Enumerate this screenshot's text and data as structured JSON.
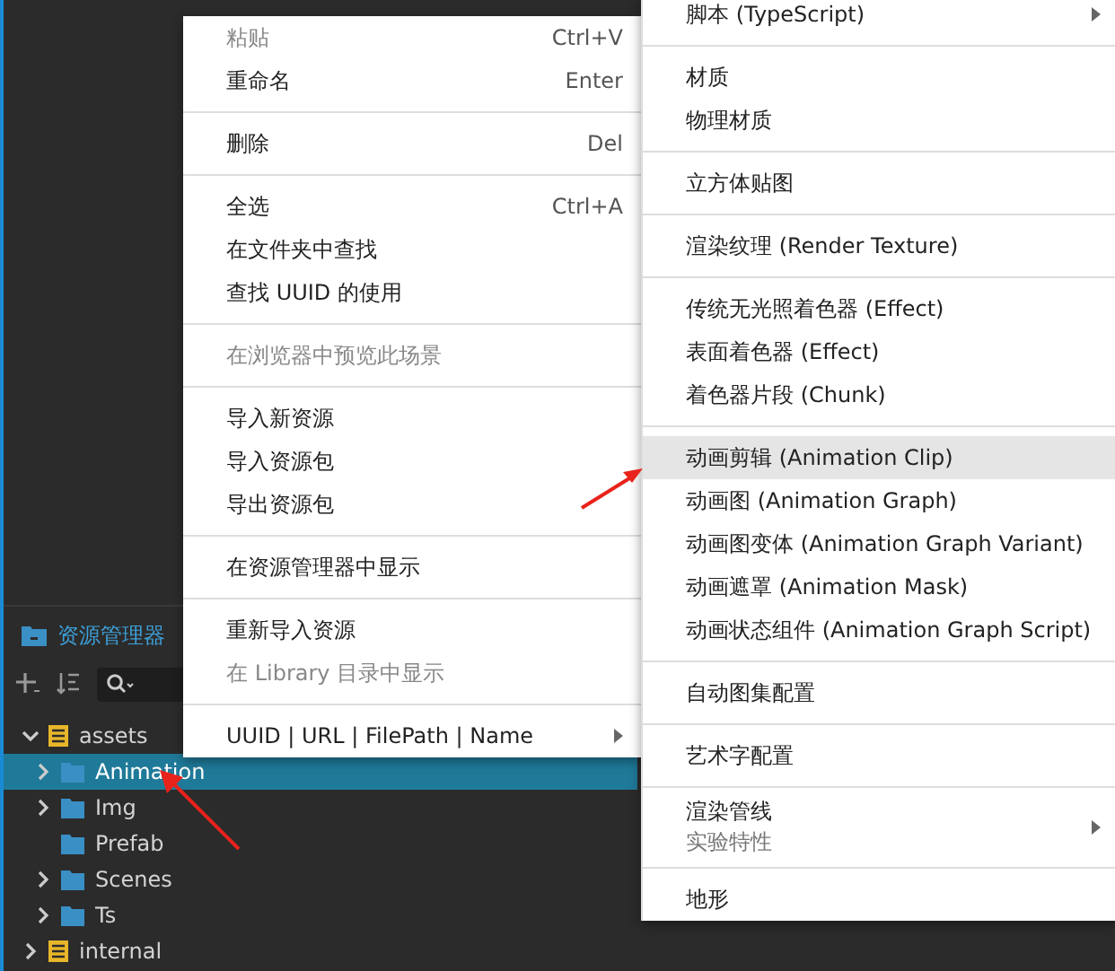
{
  "asset_panel": {
    "title": "资源管理器",
    "tree": [
      {
        "label": "assets",
        "kind": "database",
        "expandable": true,
        "expanded": true,
        "selected": false,
        "children": [
          {
            "label": "Animation",
            "kind": "folder",
            "expandable": true,
            "expanded": false,
            "selected": true
          },
          {
            "label": "Img",
            "kind": "folder",
            "expandable": true,
            "expanded": false,
            "selected": false
          },
          {
            "label": "Prefab",
            "kind": "folder",
            "selected": false
          },
          {
            "label": "Scenes",
            "kind": "folder",
            "expandable": true,
            "expanded": false,
            "selected": false
          },
          {
            "label": "Ts",
            "kind": "folder",
            "expandable": true,
            "expanded": false,
            "selected": false
          }
        ]
      },
      {
        "label": "internal",
        "kind": "database",
        "expandable": true,
        "expanded": false,
        "selected": false
      }
    ]
  },
  "context_menu": {
    "items": [
      {
        "kind": "item",
        "label": "粘贴",
        "shortcut": "Ctrl+V",
        "disabled": true
      },
      {
        "kind": "item",
        "label": "重命名",
        "shortcut": "Enter",
        "disabled": false
      },
      {
        "kind": "separator"
      },
      {
        "kind": "item",
        "label": "删除",
        "shortcut": "Del",
        "disabled": false
      },
      {
        "kind": "separator"
      },
      {
        "kind": "item",
        "label": "全选",
        "shortcut": "Ctrl+A",
        "disabled": false
      },
      {
        "kind": "item",
        "label": "在文件夹中查找",
        "disabled": false
      },
      {
        "kind": "item",
        "label": "查找 UUID 的使用",
        "disabled": false
      },
      {
        "kind": "separator"
      },
      {
        "kind": "item",
        "label": "在浏览器中预览此场景",
        "disabled": true
      },
      {
        "kind": "separator"
      },
      {
        "kind": "item",
        "label": "导入新资源",
        "disabled": false
      },
      {
        "kind": "item",
        "label": "导入资源包",
        "disabled": false
      },
      {
        "kind": "item",
        "label": "导出资源包",
        "disabled": false
      },
      {
        "kind": "separator"
      },
      {
        "kind": "item",
        "label": "在资源管理器中显示",
        "disabled": false
      },
      {
        "kind": "separator"
      },
      {
        "kind": "item",
        "label": "重新导入资源",
        "disabled": false
      },
      {
        "kind": "item",
        "label": "在 Library 目录中显示",
        "disabled": true
      },
      {
        "kind": "separator"
      },
      {
        "kind": "item",
        "label": "UUID | URL | FilePath | Name",
        "disabled": false,
        "submenu": true
      }
    ]
  },
  "create_submenu": {
    "items": [
      {
        "kind": "item",
        "label": "脚本 (TypeScript)",
        "submenu": true,
        "selected": false
      },
      {
        "kind": "separator"
      },
      {
        "kind": "item",
        "label": "材质",
        "selected": false
      },
      {
        "kind": "item",
        "label": "物理材质",
        "selected": false
      },
      {
        "kind": "separator"
      },
      {
        "kind": "item",
        "label": "立方体贴图",
        "selected": false
      },
      {
        "kind": "separator"
      },
      {
        "kind": "item",
        "label": "渲染纹理 (Render Texture)",
        "selected": false
      },
      {
        "kind": "separator"
      },
      {
        "kind": "item",
        "label": "传统无光照着色器 (Effect)",
        "selected": false
      },
      {
        "kind": "item",
        "label": "表面着色器 (Effect)",
        "selected": false
      },
      {
        "kind": "item",
        "label": "着色器片段 (Chunk)",
        "selected": false
      },
      {
        "kind": "separator"
      },
      {
        "kind": "item",
        "label": "动画剪辑 (Animation Clip)",
        "selected": true
      },
      {
        "kind": "item",
        "label": "动画图 (Animation Graph)",
        "selected": false
      },
      {
        "kind": "item",
        "label": "动画图变体 (Animation Graph Variant)",
        "selected": false
      },
      {
        "kind": "item",
        "label": "动画遮罩 (Animation Mask)",
        "selected": false
      },
      {
        "kind": "item",
        "label": "动画状态组件 (Animation Graph Script)",
        "selected": false
      },
      {
        "kind": "separator"
      },
      {
        "kind": "item",
        "label": "自动图集配置",
        "selected": false
      },
      {
        "kind": "separator"
      },
      {
        "kind": "item",
        "label": "艺术字配置",
        "selected": false
      },
      {
        "kind": "separator"
      },
      {
        "kind": "item",
        "label": "渲染管线",
        "sublabel": "实验特性",
        "submenu": true,
        "selected": false
      },
      {
        "kind": "separator"
      },
      {
        "kind": "item",
        "label": "地形",
        "selected": false
      }
    ]
  }
}
